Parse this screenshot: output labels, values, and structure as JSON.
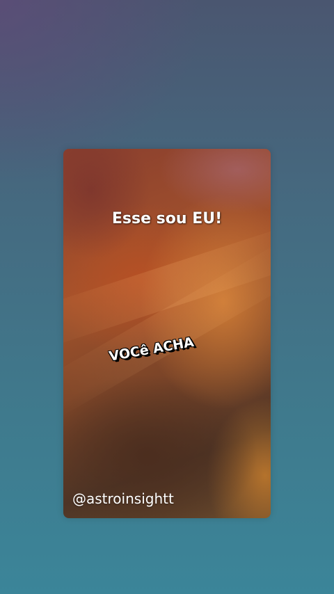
{
  "video": {
    "title": "Esse sou EU!",
    "subtitle": "VOCê ACHA",
    "handle": "@astroinsightt"
  }
}
